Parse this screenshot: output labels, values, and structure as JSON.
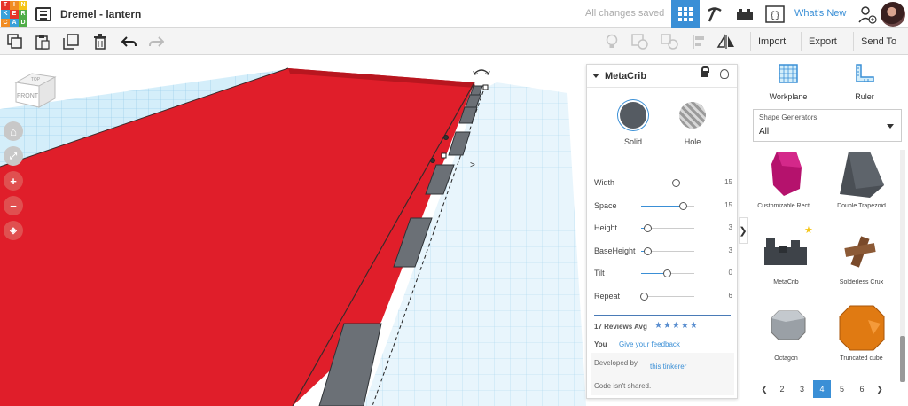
{
  "app": {
    "logo_letters": [
      "T",
      "I",
      "N",
      "K",
      "E",
      "R",
      "C",
      "A",
      "D"
    ],
    "logo_colors": [
      "#e6342a",
      "#f18c22",
      "#f5c517",
      "#3aa1d9",
      "#e6342a",
      "#4fad47",
      "#f18c22",
      "#3aa1d9",
      "#4fad47"
    ],
    "doc_title": "Dremel - lantern",
    "save_status": "All changes saved",
    "whats_new": "What's New",
    "accent_color": "#3a8fd6"
  },
  "toolbar": {
    "tools": [
      "copy-icon",
      "paste-icon",
      "duplicate-icon",
      "delete-icon",
      "undo-icon",
      "redo-icon"
    ],
    "import_label": "Import",
    "export_label": "Export",
    "send_to_label": "Send To"
  },
  "viewport": {
    "navcube_top": "TOP",
    "navcube_front": "FRONT",
    "controls": [
      "home-view-icon",
      "fit-view-icon",
      "zoom-in-icon",
      "zoom-out-icon",
      "ortho-view-icon"
    ],
    "shape_color": "#e01e2a",
    "grid_color": "#bfe4f5"
  },
  "inspector": {
    "title": "MetaCrib",
    "solid_label": "Solid",
    "hole_label": "Hole",
    "params": [
      {
        "label": "Width",
        "value": "15",
        "position": 0.65
      },
      {
        "label": "Space",
        "value": "15",
        "position": 0.78
      },
      {
        "label": "Height",
        "value": "3",
        "position": 0.12
      },
      {
        "label": "BaseHeight",
        "value": "3",
        "position": 0.12
      },
      {
        "label": "Tilt",
        "value": "0",
        "position": 0.48
      },
      {
        "label": "Repeat",
        "value": "6",
        "position": 0.05
      }
    ],
    "reviews_label": "17 Reviews Avg",
    "stars": "★★★★★",
    "you_label": "You",
    "feedback_label": "Give your feedback",
    "developed_by_label": "Developed by",
    "developer": "this tinkerer",
    "code_note": "Code isn't shared."
  },
  "sidebar": {
    "workplane_label": "Workplane",
    "ruler_label": "Ruler",
    "dropdown_label": "Shape Generators",
    "dropdown_value": "All",
    "shapes": [
      {
        "name": "Customizable Rect...",
        "color": "#b5126d"
      },
      {
        "name": "Double Trapezoid",
        "color": "#4a4f55"
      },
      {
        "name": "MetaCrib",
        "color": "#3e4349",
        "favorite": true
      },
      {
        "name": "Solderless Crux",
        "color": "#7a4a2a"
      },
      {
        "name": "Octagon",
        "color": "#9aa0a6"
      },
      {
        "name": "Truncated cube",
        "color": "#e07a12"
      }
    ],
    "pages": [
      "2",
      "3",
      "4",
      "5",
      "6"
    ],
    "active_page": "4"
  }
}
